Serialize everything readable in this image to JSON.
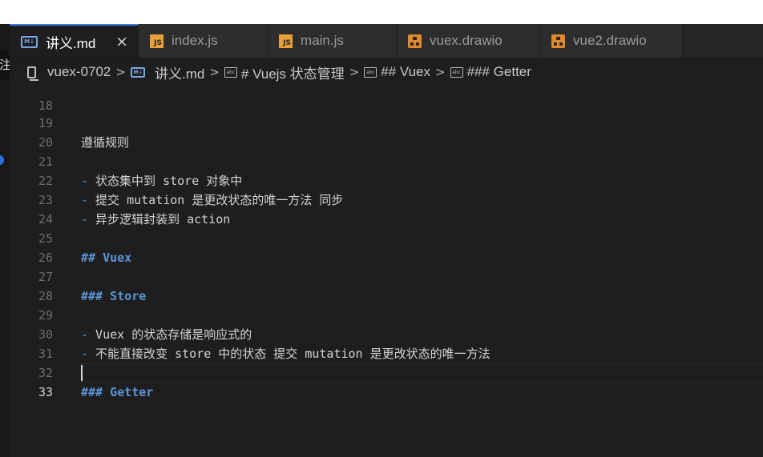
{
  "tabs": [
    {
      "label": "讲义.md",
      "icon": "markdown-icon",
      "active": true
    },
    {
      "label": "index.js",
      "icon": "js-file-icon"
    },
    {
      "label": "main.js",
      "icon": "js-file-icon"
    },
    {
      "label": "vuex.drawio",
      "icon": "drawio-icon"
    },
    {
      "label": "vue2.drawio",
      "icon": "drawio-icon"
    }
  ],
  "tab_icons": {
    "md": "M↓",
    "js": "JS"
  },
  "close_glyph": "×",
  "side_badge": "注",
  "breadcrumb": {
    "folder": "vuex-0702",
    "file": "讲义.md",
    "items": [
      "# Vuejs 状态管理",
      "## Vuex",
      "### Getter"
    ],
    "separator": ">",
    "symbol_icon": "abc"
  },
  "editor": {
    "partial_line_number": "18",
    "lines": [
      {
        "n": "19",
        "text": "遵循规则"
      },
      {
        "n": "20",
        "text": ""
      },
      {
        "n": "21",
        "prefix": "-",
        "text": " 状态集中到 store 对象中"
      },
      {
        "n": "22",
        "prefix": "-",
        "text": " 提交 mutation 是更改状态的唯一方法 同步"
      },
      {
        "n": "23",
        "prefix": "-",
        "text": " 异步逻辑封装到 action"
      },
      {
        "n": "24",
        "text": ""
      },
      {
        "n": "25",
        "heading": "## Vuex"
      },
      {
        "n": "26",
        "text": ""
      },
      {
        "n": "27",
        "heading": "### Store"
      },
      {
        "n": "28",
        "text": ""
      },
      {
        "n": "29",
        "prefix": "-",
        "text": " Vuex 的状态存储是响应式的"
      },
      {
        "n": "30",
        "prefix": "-",
        "text": " 不能直接改变 store 中的状态 提交 mutation 是更改状态的唯一方法"
      },
      {
        "n": "31",
        "text": ""
      },
      {
        "n": "32",
        "heading": "### Getter"
      },
      {
        "n": "33",
        "text": "",
        "current": true
      }
    ]
  },
  "colors": {
    "accent": "#3c7fd8",
    "heading": "#5a95d5",
    "list_marker": "#4f9ad8",
    "js_icon": "#e8a13a",
    "drawio_icon": "#e08a2c"
  }
}
